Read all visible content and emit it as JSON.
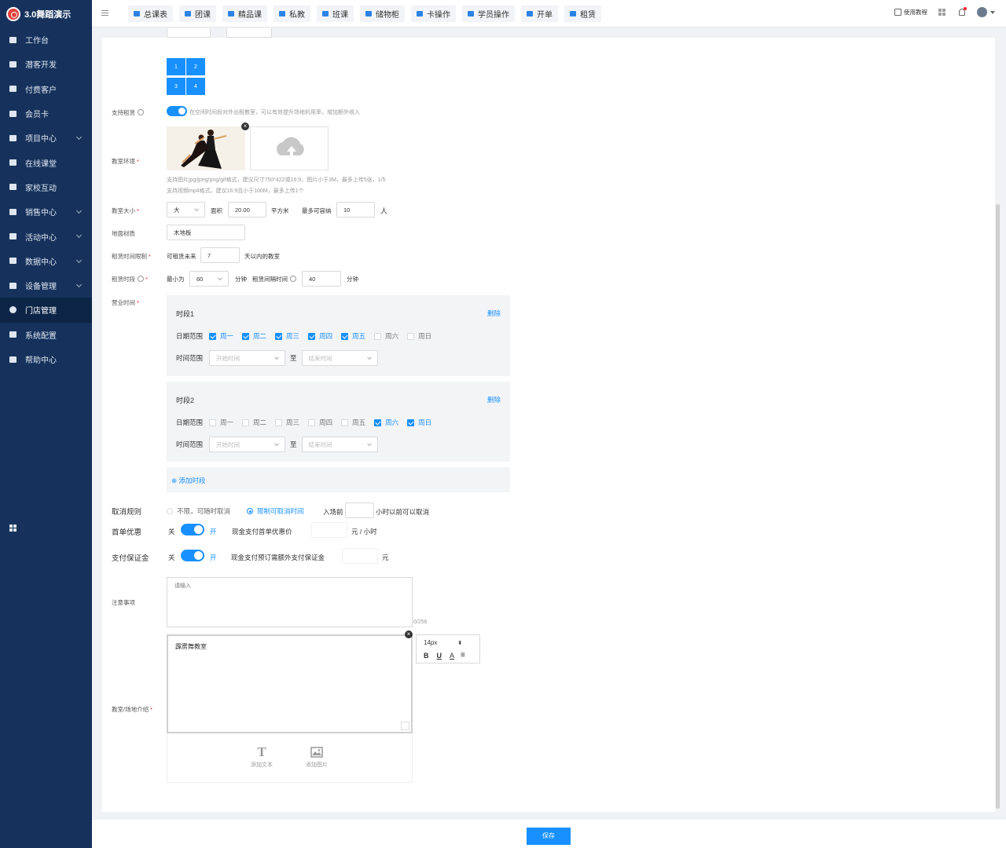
{
  "app": {
    "title": "3.0舞蹈演示"
  },
  "sidebar": {
    "items": [
      {
        "label": "工作台",
        "icon": "dashboard-icon",
        "expandable": false
      },
      {
        "label": "潜客开发",
        "icon": "prospect-icon",
        "expandable": false
      },
      {
        "label": "付费客户",
        "icon": "customers-icon",
        "expandable": false
      },
      {
        "label": "会员卡",
        "icon": "card-icon",
        "expandable": false
      },
      {
        "label": "项目中心",
        "icon": "project-icon",
        "expandable": true
      },
      {
        "label": "在线课堂",
        "icon": "classroom-icon",
        "expandable": false
      },
      {
        "label": "家校互动",
        "icon": "interaction-icon",
        "expandable": false
      },
      {
        "label": "销售中心",
        "icon": "tag-icon",
        "expandable": true
      },
      {
        "label": "活动中心",
        "icon": "activity-icon",
        "expandable": true
      },
      {
        "label": "数据中心",
        "icon": "chart-icon",
        "expandable": true
      },
      {
        "label": "设备管理",
        "icon": "device-icon",
        "expandable": true
      },
      {
        "label": "门店管理",
        "icon": "store-icon",
        "expandable": false
      },
      {
        "label": "系统配置",
        "icon": "settings-icon",
        "expandable": false
      },
      {
        "label": "帮助中心",
        "icon": "help-icon",
        "expandable": false
      }
    ],
    "active": "门店管理"
  },
  "topbar": {
    "tabs": [
      "总课表",
      "团课",
      "精品课",
      "私教",
      "班课",
      "储物柜",
      "卡操作",
      "学员操作",
      "开单",
      "租赁"
    ],
    "tutorial": "使用教程"
  },
  "form": {
    "tiles": [
      "1",
      "2",
      "3",
      "4"
    ],
    "rental": {
      "label": "支持租赁",
      "desc": "在空闲时间段对外出租教室，可以有效提升场地利用率，增加额外收入",
      "enabled": true
    },
    "environment": {
      "label": "教室环境",
      "hint1": "支持图片jpg/jpeg/png/gif格式，建议尺寸750*422或16:9，图片小于3M，最多上传5张，1/5",
      "hint2": "支持视频mp4格式，建议16:9且小于100M，最多上传1个"
    },
    "size": {
      "label": "教室大小",
      "value": "大",
      "area_label": "面积",
      "area": "20.00",
      "unit": "平方米",
      "capacity_label": "最多可容纳",
      "capacity": "10",
      "capacity_unit": "人"
    },
    "floor": {
      "label": "地面材质",
      "value": "木地板"
    },
    "rent_limit": {
      "label": "租赁时间限制",
      "prefix": "可租赁未来",
      "value": "7",
      "suffix": "天以内的教室"
    },
    "rent_slot": {
      "label": "租赁时段",
      "min_label": "最小为",
      "min": "60",
      "min_unit": "分钟",
      "interval_label": "租赁间隔时间",
      "interval": "40",
      "interval_unit": "分钟"
    },
    "hours": {
      "label": "营业时间",
      "date_label": "日期范围",
      "time_label": "时间范围",
      "start_ph": "开始时间",
      "end_ph": "结束时间",
      "to": "至",
      "delete": "删除",
      "add": "添加时段",
      "slots": [
        {
          "title": "时段1",
          "days": [
            {
              "name": "周一",
              "on": true
            },
            {
              "name": "周二",
              "on": true
            },
            {
              "name": "周三",
              "on": true
            },
            {
              "name": "周四",
              "on": true
            },
            {
              "name": "周五",
              "on": true
            },
            {
              "name": "周六",
              "on": false
            },
            {
              "name": "周日",
              "on": false
            }
          ]
        },
        {
          "title": "时段2",
          "days": [
            {
              "name": "周一",
              "on": false
            },
            {
              "name": "周二",
              "on": false
            },
            {
              "name": "周三",
              "on": false
            },
            {
              "name": "周四",
              "on": false
            },
            {
              "name": "周五",
              "on": false
            },
            {
              "name": "周六",
              "on": true
            },
            {
              "name": "周日",
              "on": true
            }
          ]
        }
      ]
    },
    "cancel": {
      "label": "取消规则",
      "opt1": "不限，可随时取消",
      "opt2": "限制可取消时间",
      "selected": "限制可取消时间",
      "before": "入场前",
      "after": "小时以前可以取消"
    },
    "first_order": {
      "label": "首单优惠",
      "off": "关",
      "on": "开",
      "desc": "现金支付首单优惠价",
      "unit": "元 / 小时",
      "enabled": true
    },
    "deposit": {
      "label": "支付保证金",
      "off": "关",
      "on": "开",
      "desc": "现金支付预订需额外支付保证金",
      "unit": "元",
      "enabled": true
    },
    "notes": {
      "label": "注意事项",
      "placeholder": "请输入",
      "counter": "0/256"
    },
    "intro": {
      "label": "教室/场地介绍",
      "content": "霹雳舞教室",
      "font_size": "14px",
      "bold": "B",
      "underline": "U",
      "color": "A",
      "add_text": "添加文本",
      "add_image": "添加图片"
    }
  },
  "footer": {
    "save": "保存"
  },
  "colors": {
    "sidebar": "#16325c",
    "accent": "#1890ff"
  }
}
